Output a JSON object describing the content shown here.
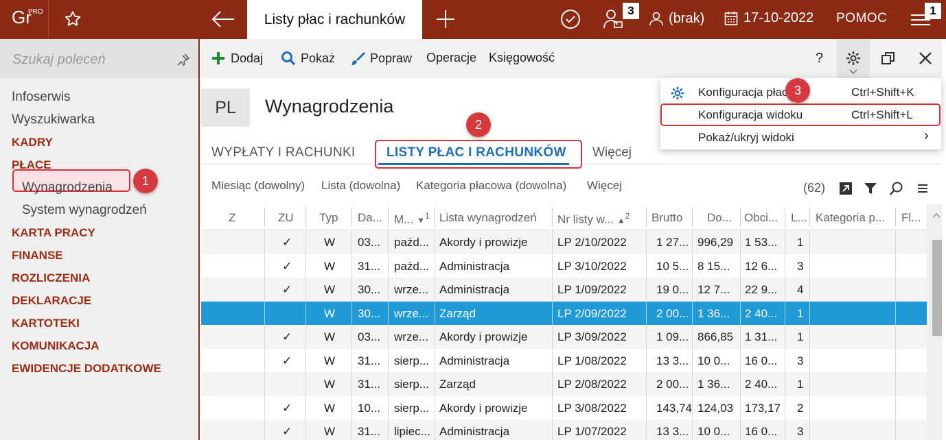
{
  "topbar": {
    "logo": "Gr",
    "logo_sup": "PRO",
    "active_tab": "Listy płac i rachunków",
    "users_badge": "3",
    "menu_badge": "1",
    "brak": "(brak)",
    "date": "17-10-2022",
    "help": "POMOC"
  },
  "sidebar": {
    "search_placeholder": "Szukaj poleceń",
    "items": [
      {
        "label": "Infoserwis",
        "type": "plain"
      },
      {
        "label": "Wyszukiwarka",
        "type": "plain"
      },
      {
        "label": "KADRY",
        "type": "cat"
      },
      {
        "label": "PŁACE",
        "type": "cat"
      },
      {
        "label": "Wynagrodzenia",
        "type": "sub"
      },
      {
        "label": "System wynagrodzeń",
        "type": "sub"
      },
      {
        "label": "KARTA PRACY",
        "type": "cat"
      },
      {
        "label": "FINANSE",
        "type": "cat"
      },
      {
        "label": "ROZLICZENIA",
        "type": "cat"
      },
      {
        "label": "DEKLARACJE",
        "type": "cat"
      },
      {
        "label": "KARTOTEKI",
        "type": "cat"
      },
      {
        "label": "KOMUNIKACJA",
        "type": "cat"
      },
      {
        "label": "EWIDENCJE DODATKOWE",
        "type": "cat"
      }
    ]
  },
  "toolbar": {
    "add": "Dodaj",
    "show": "Pokaż",
    "edit": "Popraw",
    "operations": "Operacje",
    "accounting": "Księgowość",
    "help": "?"
  },
  "header": {
    "badge": "PL",
    "title": "Wynagrodzenia"
  },
  "tabs": {
    "t1": "WYPŁATY I RACHUNKI",
    "t2": "LISTY PŁAC I RACHUNKÓW",
    "more": "Więcej"
  },
  "filters": {
    "month": "Miesiąc (dowolny)",
    "list": "Lista (dowolna)",
    "category": "Kategoria płacowa (dowolna)",
    "more": "Więcej",
    "count": "(62)"
  },
  "annotations": {
    "a1": "1",
    "a2": "2",
    "a3": "3"
  },
  "grid": {
    "columns": [
      "Z",
      "ZU",
      "Typ",
      "Da...",
      "M...",
      "Lista wynagrodzeń",
      "Nr listy w...",
      "Brutto",
      "Do...",
      "Obci...",
      "L...",
      "Kategoria p...",
      "Fl..."
    ],
    "sort1": "1",
    "sort2": "2",
    "rows": [
      {
        "zu": "✓",
        "typ": "W",
        "da": "03...",
        "m": "paźd...",
        "lista": "Akordy i prowizje",
        "nr": "LP 2/10/2022",
        "brutto": "1 27...",
        "do": "996,29",
        "obc": "1 53...",
        "l": "1"
      },
      {
        "zu": "✓",
        "typ": "W",
        "da": "31...",
        "m": "paźd...",
        "lista": "Administracja",
        "nr": "LP 3/10/2022",
        "brutto": "10 5...",
        "do": "8 15...",
        "obc": "12 6...",
        "l": "3"
      },
      {
        "zu": "✓",
        "typ": "W",
        "da": "30...",
        "m": "wrze...",
        "lista": "Administracja",
        "nr": "LP 1/09/2022",
        "brutto": "19 0...",
        "do": "12 7...",
        "obc": "22 9...",
        "l": "4"
      },
      {
        "zu": "",
        "typ": "W",
        "da": "30...",
        "m": "wrze...",
        "lista": "Zarząd",
        "nr": "LP 2/09/2022",
        "brutto": "2 00...",
        "do": "1 36...",
        "obc": "2 40...",
        "l": "1"
      },
      {
        "zu": "✓",
        "typ": "W",
        "da": "03...",
        "m": "wrze...",
        "lista": "Akordy i prowizje",
        "nr": "LP 3/09/2022",
        "brutto": "1 09...",
        "do": "866,85",
        "obc": "1 31...",
        "l": "1"
      },
      {
        "zu": "✓",
        "typ": "W",
        "da": "31...",
        "m": "sierp...",
        "lista": "Administracja",
        "nr": "LP 1/08/2022",
        "brutto": "13 3...",
        "do": "10 0...",
        "obc": "16 0...",
        "l": "3"
      },
      {
        "zu": "",
        "typ": "W",
        "da": "31...",
        "m": "sierp...",
        "lista": "Zarząd",
        "nr": "LP 2/08/2022",
        "brutto": "2 00...",
        "do": "1 36...",
        "obc": "2 40...",
        "l": "1"
      },
      {
        "zu": "✓",
        "typ": "W",
        "da": "10...",
        "m": "sierp...",
        "lista": "Akordy i prowizje",
        "nr": "LP 3/08/2022",
        "brutto": "143,74",
        "do": "124,03",
        "obc": "173,17",
        "l": "2"
      },
      {
        "zu": "✓",
        "typ": "W",
        "da": "31...",
        "m": "lipiec...",
        "lista": "Administracja",
        "nr": "LP 1/07/2022",
        "brutto": "13 3...",
        "do": "10 0...",
        "obc": "16 0...",
        "l": "3"
      }
    ]
  },
  "dropdown": {
    "items": [
      {
        "label": "Konfiguracja płac",
        "shortcut": "Ctrl+Shift+K"
      },
      {
        "label": "Konfiguracja widoku",
        "shortcut": "Ctrl+Shift+L"
      },
      {
        "label": "Pokaż/ukryj widoki",
        "shortcut": "›"
      }
    ]
  },
  "colors": {
    "brand": "#8c2a14",
    "accent": "#1d6fb8",
    "selection": "#1f9ad6",
    "annotation": "#d63a3f"
  }
}
